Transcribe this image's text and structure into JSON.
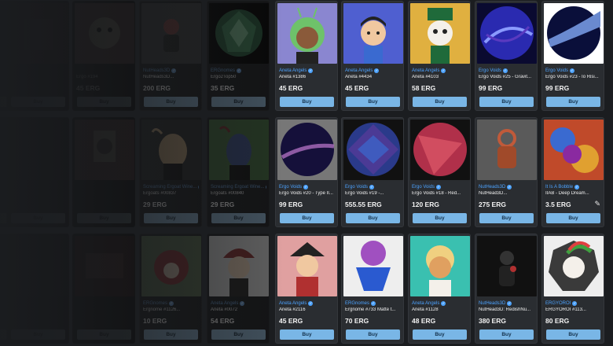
{
  "buy_label": "Buy",
  "verified_mark": "✓",
  "brush_icon": "paintbrush-icon",
  "colors": {
    "accent_link": "#4da3ff",
    "buy_button": "#79b6e6",
    "card_bg": "#2a2d31",
    "page_bg": "#1b1d20"
  },
  "rows": [
    [
      {
        "collection": "",
        "title": "",
        "price": "",
        "art": "blank"
      },
      {
        "collection": "",
        "title": "",
        "price": "",
        "art": "red"
      },
      {
        "collection": "",
        "title": "Ergo #194",
        "price": "45 ERG",
        "art": "cartoon_yellow"
      },
      {
        "collection": "NutHeads3D",
        "title": "NutHeads3D...",
        "price": "200 ERG",
        "art": "figure_dark"
      },
      {
        "collection": "ERGnomes",
        "title": "Ergo2Top50",
        "price": "35 ERG",
        "art": "crystal"
      },
      {
        "collection": "Aneta Angels",
        "title": "Aneta #1386",
        "price": "45 ERG",
        "art": "alien_girl"
      },
      {
        "collection": "Aneta Angels",
        "title": "Aneta #4434",
        "price": "45 ERG",
        "art": "angel_blue"
      },
      {
        "collection": "Aneta Angels",
        "title": "Aneta #4103",
        "price": "58 ERG",
        "art": "skull_hat"
      },
      {
        "collection": "Ergo Voids",
        "title": "Ergo Voids #25 - Gravit...",
        "price": "99 ERG",
        "art": "void_blue"
      },
      {
        "collection": "Ergo Voids",
        "title": "Ergo Voids #23 - Io Risi...",
        "price": "99 ERG",
        "art": "void_planet"
      }
    ],
    [
      {
        "collection": "",
        "title": "",
        "price": "",
        "art": "blank"
      },
      {
        "collection": "",
        "title": "",
        "price": "",
        "art": "blank"
      },
      {
        "collection": "",
        "title": "",
        "price": "",
        "art": "pharaoh"
      },
      {
        "collection": "Screaming Ergoat Wine...",
        "title": "Ergoats #00837",
        "price": "29 ERG",
        "art": "goat_tan"
      },
      {
        "collection": "Screaming Ergoat Wine...",
        "title": "Ergoats #00840",
        "price": "29 ERG",
        "art": "goat_blue"
      },
      {
        "collection": "Ergo Voids",
        "title": "Ergo Voids #20 - Type II...",
        "price": "99 ERG",
        "art": "void_galaxy"
      },
      {
        "collection": "Ergo Voids",
        "title": "Ergo Voids #19 -...",
        "price": "555.55 ERG",
        "art": "void_geo"
      },
      {
        "collection": "Ergo Voids",
        "title": "Ergo Voids #18 - Red...",
        "price": "120 ERG",
        "art": "void_red"
      },
      {
        "collection": "NutHeads3D",
        "title": "NutHead3D...",
        "price": "275 ERG",
        "art": "nut_robot"
      },
      {
        "collection": "It Is A Bobble",
        "title": "IIAB - Deep Dream...",
        "price": "3.5 ERG",
        "art": "bobble"
      }
    ],
    [
      {
        "collection": "",
        "title": "",
        "price": "",
        "art": "blank"
      },
      {
        "collection": "",
        "title": "",
        "price": "",
        "art": "blank"
      },
      {
        "collection": "",
        "title": "",
        "price": "",
        "art": "red_block"
      },
      {
        "collection": "ERGnomes",
        "title": "Ergnome #1126...",
        "price": "10 ERG",
        "art": "gnome_red"
      },
      {
        "collection": "Aneta Angels",
        "title": "Aneta #0072",
        "price": "54 ERG",
        "art": "fireman"
      },
      {
        "collection": "Aneta Angels",
        "title": "Aneta #2116",
        "price": "45 ERG",
        "art": "samurai"
      },
      {
        "collection": "ERGnomes",
        "title": "Ergnome #733 Matte t...",
        "price": "70 ERG",
        "art": "gnome_blue"
      },
      {
        "collection": "Aneta Angels",
        "title": "Aneta #1128",
        "price": "48 ERG",
        "art": "angel_teal"
      },
      {
        "collection": "NutHeads3D",
        "title": "NutHead3D: RedishNu...",
        "price": "380 ERG",
        "art": "nut_black"
      },
      {
        "collection": "ERGYOROI",
        "title": "ERGYOROI #113...",
        "price": "80 ERG",
        "art": "ergyoroi"
      }
    ]
  ]
}
